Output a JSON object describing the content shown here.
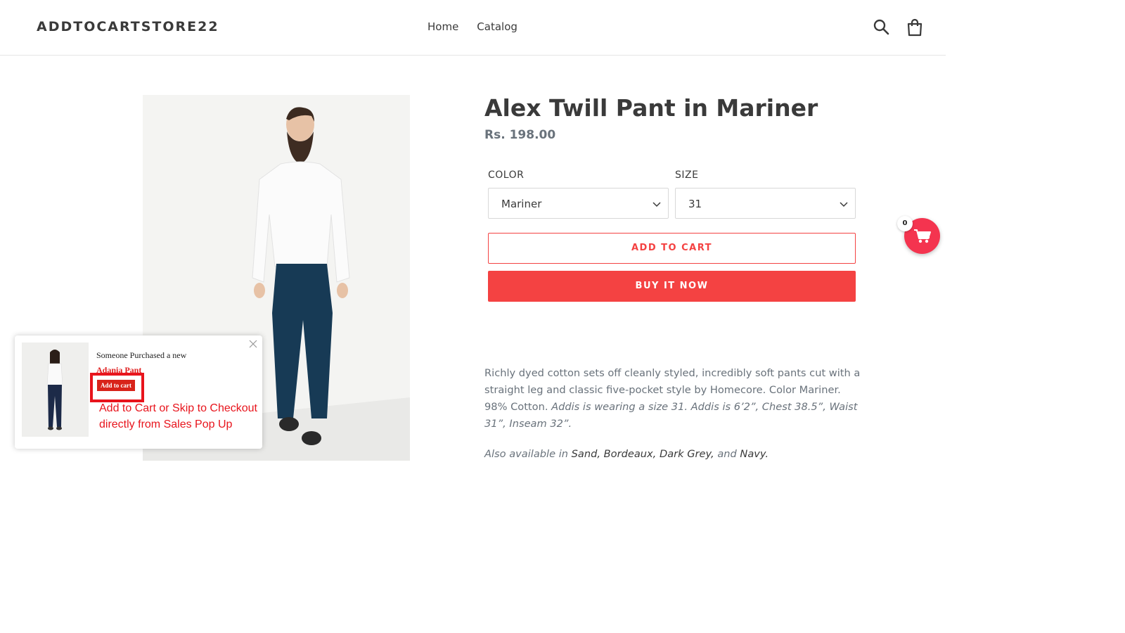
{
  "header": {
    "logo": "ADDTOCARTSTORE22",
    "nav": [
      {
        "label": "Home"
      },
      {
        "label": "Catalog"
      }
    ],
    "icons": [
      "search-icon",
      "cart-icon"
    ]
  },
  "product": {
    "title": "Alex Twill Pant in Mariner",
    "price": "Rs. 198.00",
    "color_label": "COLOR",
    "color_value": "Mariner",
    "size_label": "SIZE",
    "size_value": "31",
    "add_to_cart": "ADD TO CART",
    "buy_now": "BUY IT NOW",
    "description": {
      "plain": "Richly dyed cotton sets off cleanly styled, incredibly soft pants cut with a straight leg and classic five-pocket style by Homecore. Color Mariner. 98% Cotton.",
      "italic": "Addis is wearing a size 31. Addis is 6’2”, Chest 38.5”, Waist 31”, Inseam 32”."
    },
    "also_available": {
      "prefix": "Also available in",
      "sand": "Sand,",
      "bordeaux": "Bordeaux,",
      "dark_grey": "Dark Grey,",
      "and": "and",
      "navy": "Navy."
    }
  },
  "floating_cart": {
    "count": "0",
    "color": "#f4344f"
  },
  "sales_popup": {
    "message": "Someone Purchased a new",
    "product_name": "Adania Pant",
    "button_label": "Add to cart",
    "annotation_line1": "Add to Cart or Skip to Checkout",
    "annotation_line2": "directly from Sales Pop Up"
  },
  "colors": {
    "accent": "#f44242",
    "text": "#3a3a3a",
    "muted": "#69727b"
  }
}
